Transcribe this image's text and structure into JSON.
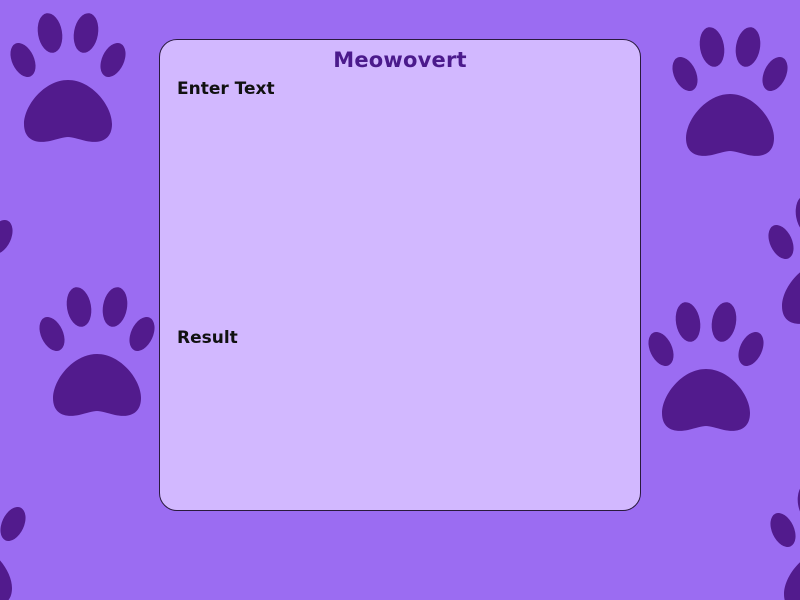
{
  "app": {
    "title": "Meowovert"
  },
  "input": {
    "label": "Enter Text",
    "value": "",
    "placeholder": ""
  },
  "output": {
    "label": "Result",
    "value": ""
  },
  "colors": {
    "background": "#9b6cf2",
    "paw": "#521b8d",
    "card": "#d2b8ff",
    "title": "#4b1a8c"
  },
  "decorations": {
    "background_icon": "paw-print-icon"
  }
}
